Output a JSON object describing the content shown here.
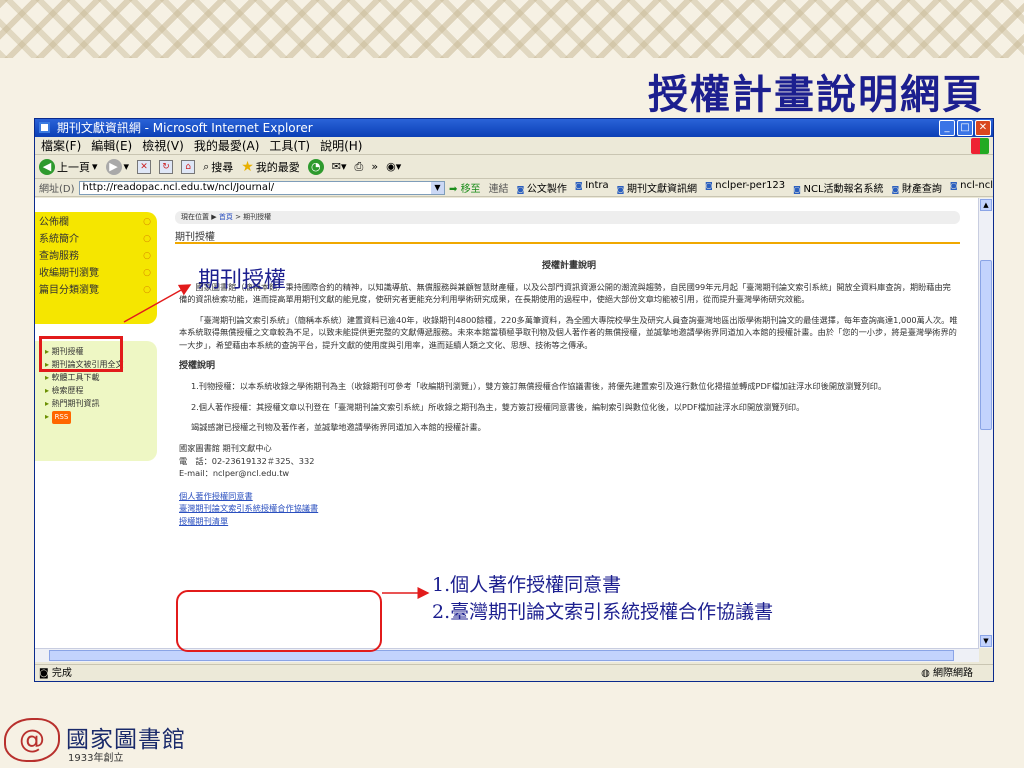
{
  "slide": {
    "title": "授權計畫說明網頁",
    "footer": {
      "library_name": "國家圖書館",
      "founded": "1933年創立"
    }
  },
  "browser": {
    "window_title": "期刊文獻資訊網 - Microsoft Internet Explorer",
    "menu": [
      "檔案(F)",
      "編輯(E)",
      "檢視(V)",
      "我的最愛(A)",
      "工具(T)",
      "說明(H)"
    ],
    "toolbar": {
      "back": "上一頁",
      "search": "搜尋",
      "favorites": "我的最愛"
    },
    "address_label": "網址(D)",
    "address": "http://readopac.ncl.edu.tw/ncl/Journal/",
    "go_label": "移至",
    "links_label": "連結",
    "links": [
      "公文製作",
      "Intra",
      "期刊文獻資訊網",
      "nclper-per123",
      "NCL活動報名系統",
      "財產查詢",
      "ncl-ncl"
    ],
    "status": "完成",
    "zone": "網際網路"
  },
  "page": {
    "sidebar_menu": [
      "公佈欄",
      "系統簡介",
      "查詢服務",
      "收編期刊瀏覽",
      "篇目分類瀏覽"
    ],
    "sidebar_sub": [
      "期刊授權",
      "期刊論文被引用全文",
      "軟體工具下載",
      "檢索歷程",
      "熱門期刊資訊"
    ],
    "rss": "RSS",
    "breadcrumb": {
      "prefix": "現在位置",
      "home": "首頁",
      "current": "> 期刊授權"
    },
    "heading": "期刊授權",
    "content_title": "授權計畫說明",
    "p1": "國家圖書館（簡稱本館）秉持國際合約的精神，以知識導航、無償服務與兼顧智慧財產權，以及公部門資訊資源公開的潮流與趨勢，自民國99年元月起「臺灣期刊論文索引系統」開放全資料庫查詢，期盼藉由完備的資訊檢索功能，進而提高單用期刊文獻的能見度，使研究者更能充分利用學術研究成果，在長期使用的過程中，使絕大部份文章均能被引用，從而提升臺灣學術研究效能。",
    "p2": "「臺灣期刊論文索引系統」（簡稱本系統）建置資料已逾40年，收錄期刊4800餘種，220多萬筆資料，為全國大專院校學生及研究人員查詢臺灣地區出版學術期刊論文的最佳選擇，每年查詢高達1,000萬人次。唯本系統取得無償授權之文章較為不足，以致未能提供更完整的文獻傳遞服務。未來本館當積極爭取刊物及個人著作者的無償授權，並誠摯地邀請學術界同道加入本館的授權計畫。由於「您的一小步，將是臺灣學術界的一大步」，希望藉由本系統的查詢平台，提升文獻的使用度與引用率，進而延續人類之文化、思想、技術等之傳承。",
    "auth_heading": "授權說明",
    "item1_label": "刊物授權",
    "item1": "1.刊物授權：以本系統收錄之學術期刊為主（收錄期刊可參考「收編期刊瀏覽」），雙方簽訂無償授權合作協議書後，將優先建置索引及進行數位化掃描並轉成PDF檔加註浮水印後開放瀏覽列印。",
    "item2": "2.個人著作授權：其授權文章以刊登在「臺灣期刊論文索引系統」所收錄之期刊為主，雙方簽訂授權同意書後，編制索引與數位化後，以PDF檔加註浮水印開放瀏覽列印。",
    "thanks": "竭誠感謝已授權之刊物及著作者，並誠摯地邀請學術界同道加入本館的授權計畫。",
    "contact": [
      "國家圖書館 期刊文獻中心",
      "電　話：02-23619132＃325、332",
      "E-mail：nclper@ncl.edu.tw"
    ],
    "doc_links": [
      "個人著作授權同意書",
      "臺灣期刊論文索引系統授權合作協議書",
      "授權期刊清單"
    ]
  },
  "annotations": {
    "callout": "期刊授權",
    "list": [
      "1.個人著作授權同意書",
      "2.臺灣期刊論文索引系統授權合作協議書"
    ]
  }
}
